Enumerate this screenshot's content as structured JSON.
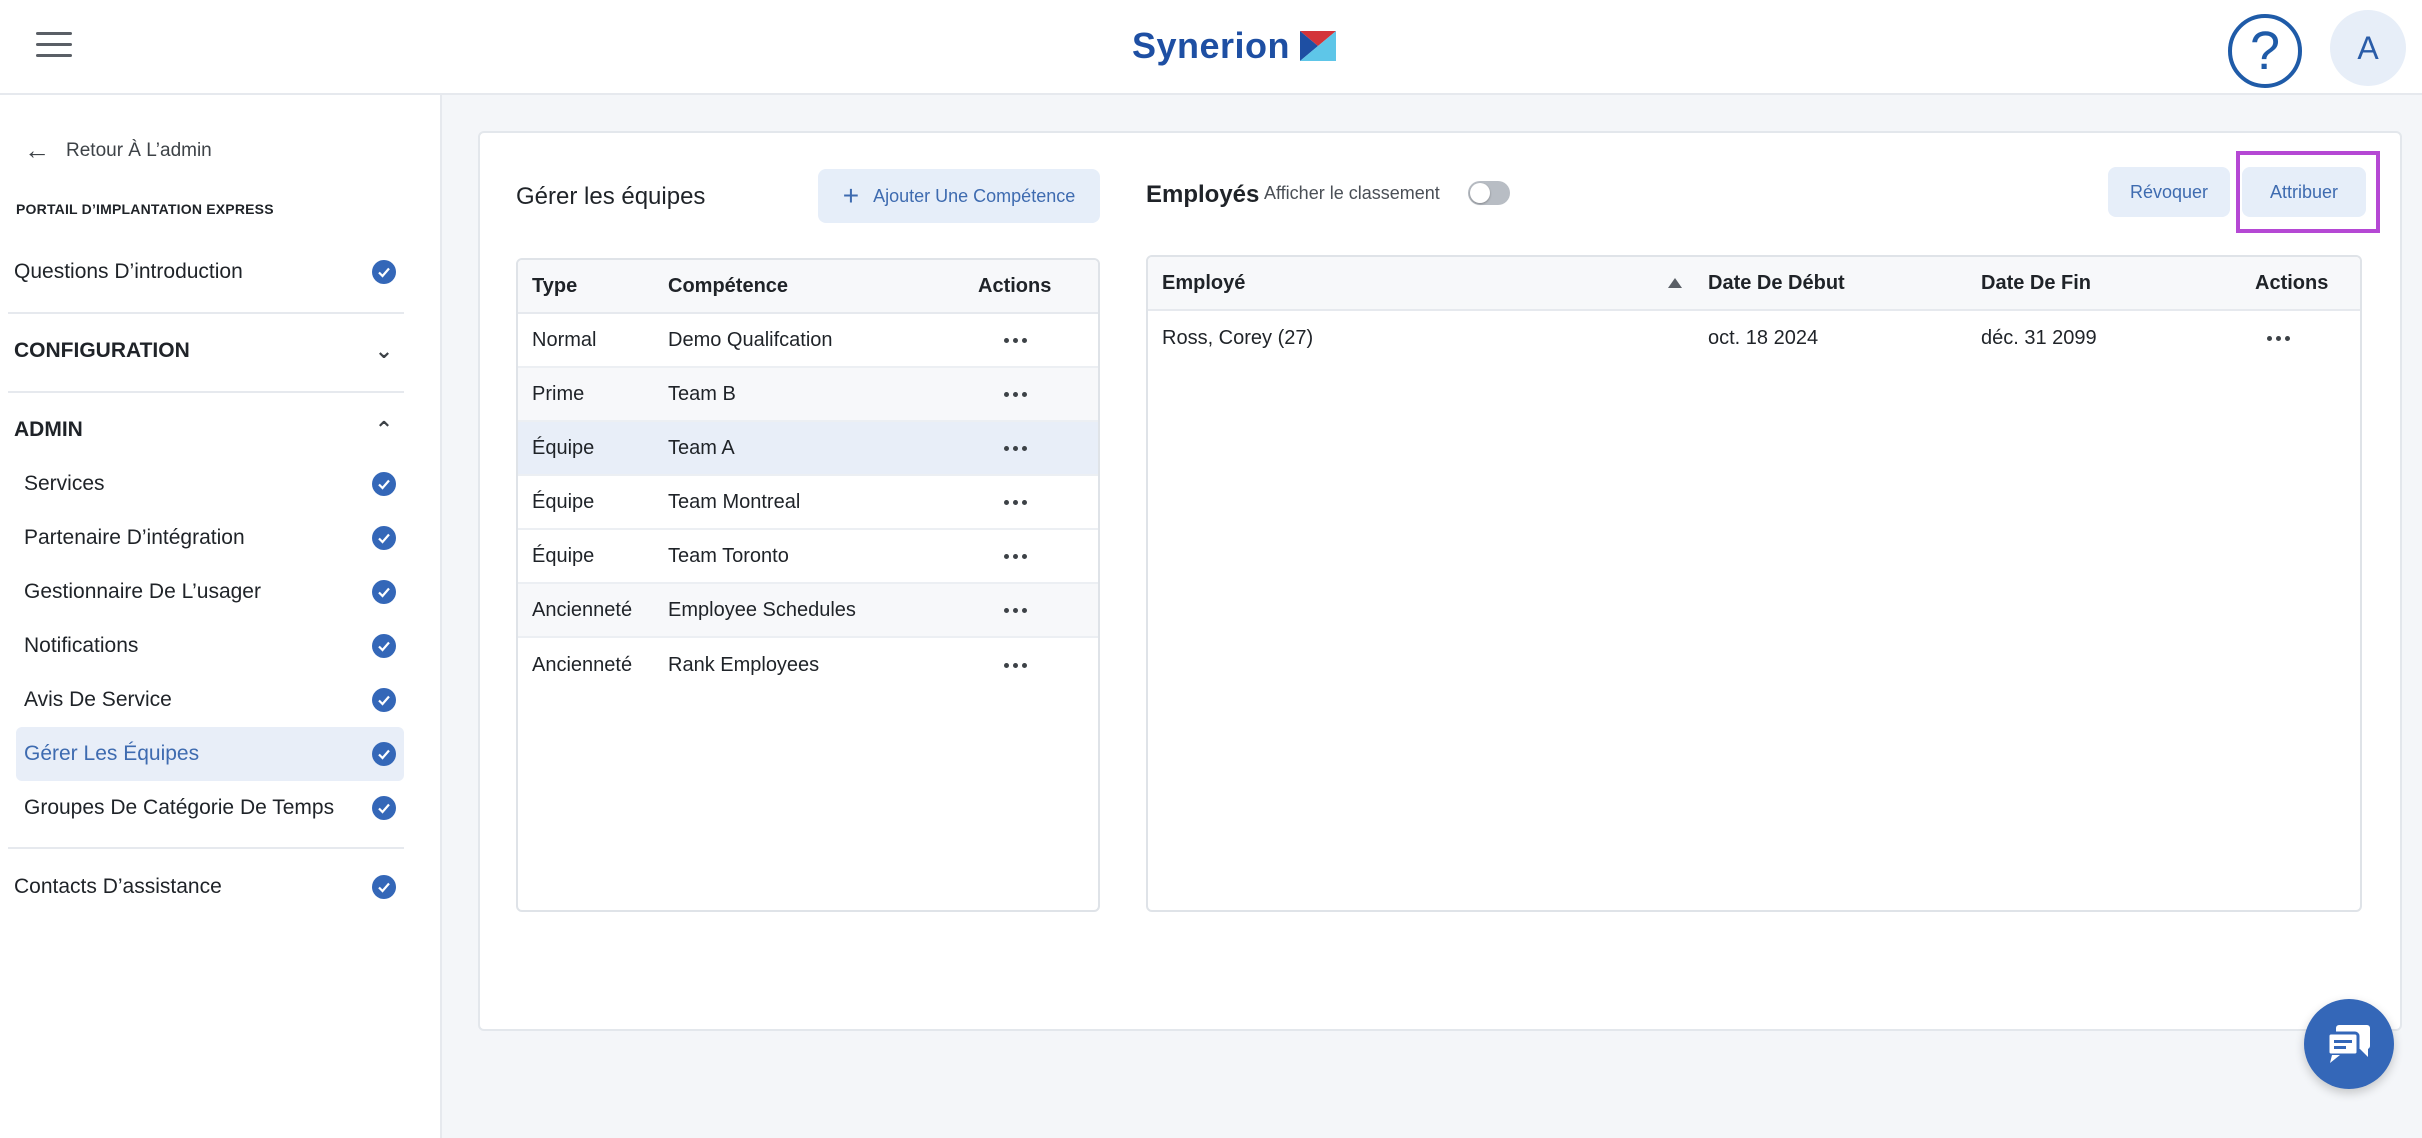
{
  "header": {
    "logo_text": "Synerion",
    "help_icon": "help-circle-icon",
    "avatar_initial": "A",
    "accent": "#1e4fa3"
  },
  "sidebar": {
    "back_label": "Retour À L’admin",
    "portal_label": "PORTAIL D’IMPLANTATION EXPRESS",
    "intro": "Questions D’introduction",
    "configuration": "CONFIGURATION",
    "admin": "ADMIN",
    "admin_items": [
      "Services",
      "Partenaire D’intégration",
      "Gestionnaire De L’usager",
      "Notifications",
      "Avis De Service",
      "Gérer Les Équipes",
      "Groupes De Catégorie De Temps"
    ],
    "support": "Contacts D’assistance"
  },
  "teams": {
    "title": "Gérer les équipes",
    "add_label": "Ajouter Une Compétence",
    "columns": [
      "Type",
      "Compétence",
      "Actions"
    ],
    "rows": [
      {
        "type": "Normal",
        "skill": "Demo Qualifcation"
      },
      {
        "type": "Prime",
        "skill": "Team B"
      },
      {
        "type": "Équipe",
        "skill": "Team A"
      },
      {
        "type": "Équipe",
        "skill": "Team Montreal"
      },
      {
        "type": "Équipe",
        "skill": "Team Toronto"
      },
      {
        "type": "Ancienneté",
        "skill": "Employee Schedules"
      },
      {
        "type": "Ancienneté",
        "skill": "Rank Employees"
      }
    ]
  },
  "employees": {
    "title": "Employés",
    "toggle_label": "Afficher le classement",
    "revoke_label": "Révoquer",
    "assign_label": "Attribuer",
    "columns": [
      "Employé",
      "Date De Début",
      "Date De Fin",
      "Actions"
    ],
    "rows": [
      {
        "name": "Ross, Corey (27)",
        "start": "oct. 18 2024",
        "end": "déc. 31 2099"
      }
    ]
  }
}
